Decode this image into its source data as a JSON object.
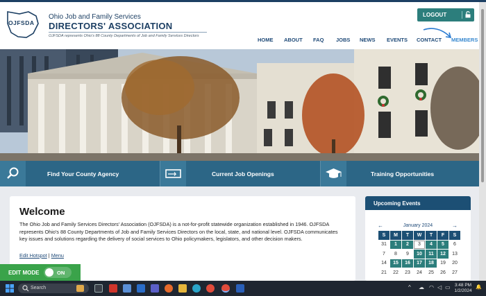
{
  "header": {
    "logo_text": "OJFSDA",
    "org_line1": "Ohio Job and Family Services",
    "org_line2": "DIRECTORS' ASSOCIATION",
    "tagline": "OJFSDA represents Ohio's 88 County Departments of Job and Family Services Directors",
    "logout_label": "LOGOUT"
  },
  "nav": {
    "items": [
      "HOME",
      "ABOUT",
      "FAQ",
      "JOBS",
      "NEWS",
      "EVENTS",
      "CONTACT",
      "MEMBERS"
    ]
  },
  "quicklinks": [
    {
      "label": "Find Your County Agency",
      "icon": "search-icon"
    },
    {
      "label": "Current Job Openings",
      "icon": "ticket-icon"
    },
    {
      "label": "Training Opportunities",
      "icon": "graduation-cap-icon"
    }
  ],
  "welcome": {
    "title": "Welcome",
    "body": "The Ohio Job and Family Services Directors' Association (OJFSDA) is a not-for-profit statewide organization established in 1946. OJFSDA represents Ohio's 88 County Departments of Job and Family Services Directors on the local, state, and national level. OJFSDA communicates key issues and solutions regarding the delivery of social services to Ohio policymakers, legislators, and other decision makers.",
    "edit_hotspot": "Edit Hotspot",
    "link_sep": "|",
    "menu_link": "Menu"
  },
  "edit_mode": {
    "label": "EDIT MODE",
    "state": "ON"
  },
  "events": {
    "title": "Upcoming Events",
    "prev": "←",
    "next": "→",
    "month": "January 2024",
    "weekdays": [
      "S",
      "M",
      "T",
      "W",
      "T",
      "F",
      "S"
    ],
    "weeks": [
      [
        {
          "d": "31",
          "s": "n"
        },
        {
          "d": "1",
          "s": "e"
        },
        {
          "d": "2",
          "s": "e"
        },
        {
          "d": "3",
          "s": "t"
        },
        {
          "d": "4",
          "s": "e"
        },
        {
          "d": "5",
          "s": "e"
        },
        {
          "d": "6",
          "s": "n"
        }
      ],
      [
        {
          "d": "7",
          "s": "n"
        },
        {
          "d": "8",
          "s": "n"
        },
        {
          "d": "9",
          "s": "n"
        },
        {
          "d": "10",
          "s": "e"
        },
        {
          "d": "11",
          "s": "e"
        },
        {
          "d": "12",
          "s": "e"
        },
        {
          "d": "13",
          "s": "n"
        }
      ],
      [
        {
          "d": "14",
          "s": "n"
        },
        {
          "d": "15",
          "s": "e"
        },
        {
          "d": "16",
          "s": "e"
        },
        {
          "d": "17",
          "s": "e"
        },
        {
          "d": "18",
          "s": "e"
        },
        {
          "d": "19",
          "s": "n"
        },
        {
          "d": "20",
          "s": "n"
        }
      ],
      [
        {
          "d": "21",
          "s": "n"
        },
        {
          "d": "22",
          "s": "n"
        },
        {
          "d": "23",
          "s": "n"
        },
        {
          "d": "24",
          "s": "n"
        },
        {
          "d": "25",
          "s": "n"
        },
        {
          "d": "26",
          "s": "n"
        },
        {
          "d": "27",
          "s": "n"
        }
      ]
    ]
  },
  "taskbar": {
    "search_placeholder": "Search",
    "time": "3:48 PM",
    "date": "1/2/2024"
  },
  "colors": {
    "navy": "#1c3f63",
    "teal": "#2c7e7c",
    "quickbar": "#2c6686",
    "edit_green": "#3aa34a"
  }
}
